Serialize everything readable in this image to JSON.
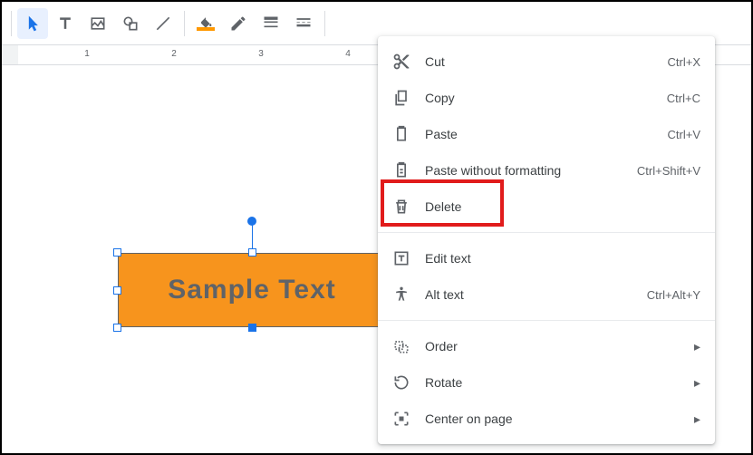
{
  "ruler": {
    "ticks": [
      "1",
      "2",
      "3",
      "4"
    ]
  },
  "shape": {
    "text": "Sample Text",
    "fill": "#f7941d"
  },
  "menu": {
    "cut": {
      "label": "Cut",
      "shortcut": "Ctrl+X"
    },
    "copy": {
      "label": "Copy",
      "shortcut": "Ctrl+C"
    },
    "paste": {
      "label": "Paste",
      "shortcut": "Ctrl+V"
    },
    "paste_plain": {
      "label": "Paste without formatting",
      "shortcut": "Ctrl+Shift+V"
    },
    "delete": {
      "label": "Delete"
    },
    "edit_text": {
      "label": "Edit text"
    },
    "alt_text": {
      "label": "Alt text",
      "shortcut": "Ctrl+Alt+Y"
    },
    "order": {
      "label": "Order"
    },
    "rotate": {
      "label": "Rotate"
    },
    "center": {
      "label": "Center on page"
    }
  }
}
